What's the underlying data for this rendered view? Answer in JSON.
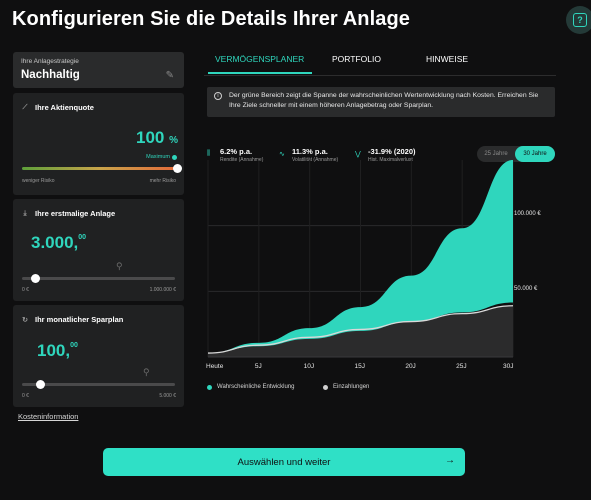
{
  "page": {
    "title": "Konfigurieren Sie die Details Ihrer Anlage"
  },
  "help": {
    "icon": "help-icon",
    "glyph": "?"
  },
  "strategy": {
    "label": "Ihre Anlagestrategie",
    "value": "Nachhaltig",
    "edit_icon": "pencil-icon"
  },
  "aktienquote": {
    "title": "Ihre Aktienquote",
    "value": "100",
    "unit": "%",
    "badge": "Maximum",
    "min_label": "weniger Risiko",
    "max_label": "mehr Risiko",
    "level_pct": 100
  },
  "erstmalig": {
    "title": "Ihre erstmalige Anlage",
    "value": "3.000,",
    "cents": "00",
    "min_label": "0 €",
    "max_label": "1.000.000 €"
  },
  "sparplan": {
    "title": "Ihr monatlicher Sparplan",
    "value": "100,",
    "cents": "00",
    "min_label": "0 €",
    "max_label": "5.000 €"
  },
  "kosten_link": "Kosteninformation",
  "tabs": [
    {
      "label": "VERMÖGENSPLANER",
      "active": true
    },
    {
      "label": "PORTFOLIO",
      "active": false
    },
    {
      "label": "HINWEISE",
      "active": false
    }
  ],
  "info": {
    "icon": "info-icon",
    "text": "Der grüne Bereich zeigt die Spanne der wahrscheinlichen Wertentwicklung nach Kosten. Erreichen Sie Ihre Ziele schneller mit einem höheren Anlagebetrag oder Sparplan."
  },
  "stats": [
    {
      "value": "6.2% p.a.",
      "label": "Rendite (Annahme)",
      "icon": "bar-icon"
    },
    {
      "value": "11.3% p.a.",
      "label": "Volatilität (Annahme)",
      "icon": "wave-icon"
    },
    {
      "value": "-31.9% (2020)",
      "label": "Hist. Maximalverlust",
      "icon": "drawdown-icon"
    }
  ],
  "year_toggle": {
    "options": [
      "25 Jahre",
      "30 Jahre"
    ],
    "selected": "30 Jahre"
  },
  "chart_data": {
    "type": "area",
    "x": [
      "Heute",
      "5J",
      "10J",
      "15J",
      "20J",
      "25J",
      "30J"
    ],
    "x_years": [
      0,
      5,
      10,
      15,
      20,
      25,
      30
    ],
    "y_tick_labels": [
      "50.000 €",
      "100.000 €"
    ],
    "y_ticks": [
      50000,
      100000
    ],
    "ylim": [
      0,
      150000
    ],
    "series": [
      {
        "name": "Wahrscheinliche Entwicklung",
        "color": "#2fd6bd",
        "lower": [
          3000,
          8200,
          13800,
          19900,
          26800,
          34000,
          41500
        ],
        "upper": [
          3000,
          10800,
          22000,
          38000,
          62000,
          98000,
          150000
        ]
      },
      {
        "name": "Einzahlungen",
        "color": "#cfcfcf",
        "values": [
          3000,
          9000,
          15000,
          21000,
          27000,
          33000,
          39000
        ]
      }
    ],
    "grid": true,
    "legend": "bottom"
  },
  "cta": {
    "label": "Auswählen und weiter",
    "icon": "arrow-right-icon",
    "glyph": "→"
  }
}
